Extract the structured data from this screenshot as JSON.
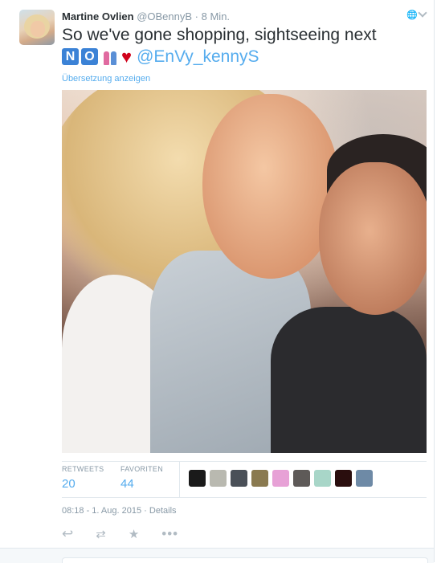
{
  "tweet": {
    "fullname": "Martine Ovlien",
    "username": "@OBennyB",
    "separator": "·",
    "time": "8 Min.",
    "text_line1": "So we've gone shopping, sightseeing next",
    "emoji_no_n": "N",
    "emoji_no_o": "O",
    "mention": "@EnVy_kennyS",
    "translate_link": "Übersetzung anzeigen",
    "timestamp": "08:18 - 1. Aug. 2015",
    "details_sep": "·",
    "details_link": "Details"
  },
  "stats": {
    "retweets_label": "RETWEETS",
    "retweets_value": "20",
    "favorites_label": "FAVORITEN",
    "favorites_value": "44"
  },
  "favoriters": [
    {
      "color": "#1a1a1a"
    },
    {
      "color": "#b9b9b0"
    },
    {
      "color": "#4a5058"
    },
    {
      "color": "#8a7a50"
    },
    {
      "color": "#e7a1d6"
    },
    {
      "color": "#5e5a58"
    },
    {
      "color": "#a8d6c8"
    },
    {
      "color": "#2a0e0e"
    },
    {
      "color": "#6e8aa6"
    }
  ],
  "actions": {
    "reply_icon": "↩",
    "retweet_icon": "⇄",
    "favorite_icon": "★",
    "more_icon": "•••"
  },
  "icons": {
    "globe": "🌐"
  },
  "colors": {
    "link": "#55acee",
    "muted": "#8899a6",
    "heart": "#d0021b"
  }
}
